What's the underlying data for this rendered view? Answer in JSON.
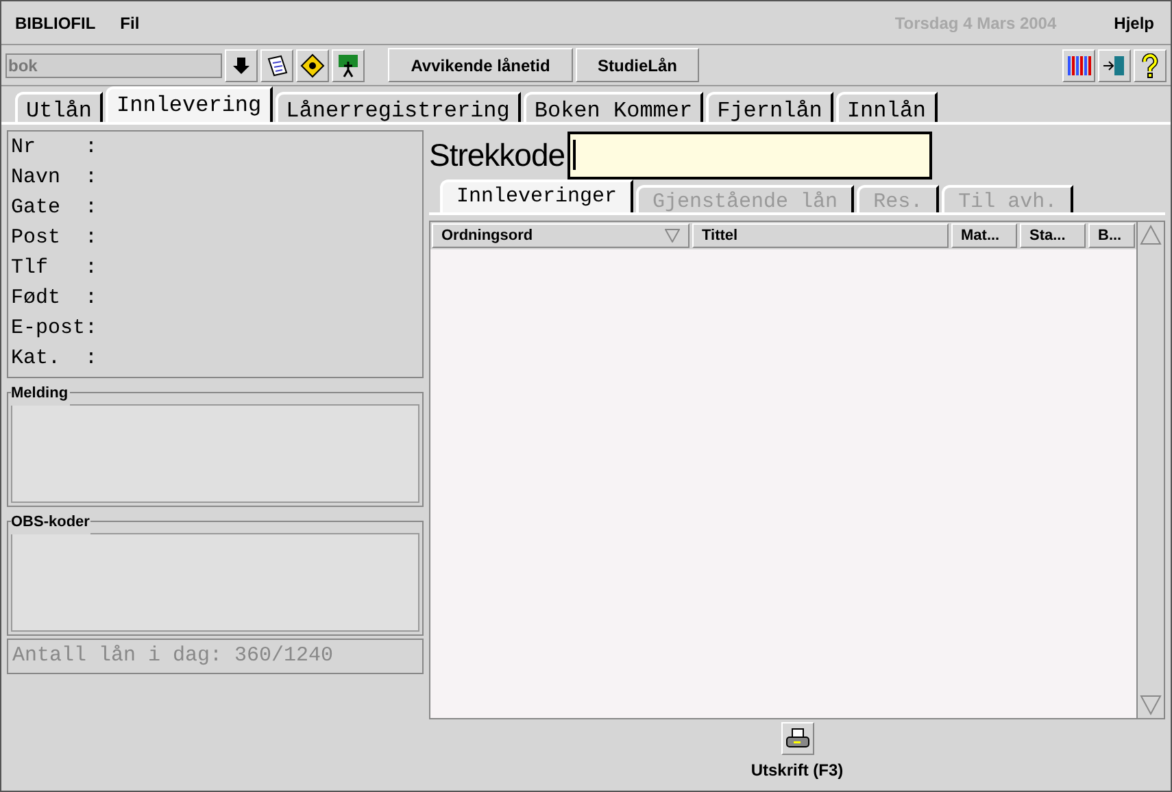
{
  "menu": {
    "app": "BIBLIOFIL",
    "items": [
      "Fil"
    ],
    "date": "Torsdag 4 Mars 2004",
    "help": "Hjelp"
  },
  "toolbar": {
    "search_value": "bok",
    "buttons": [
      "Avvikende lånetid",
      "StudieLån"
    ]
  },
  "tabs": [
    {
      "label": "Utlån",
      "selected": false
    },
    {
      "label": "Innlevering",
      "selected": true
    },
    {
      "label": "Lånerregistrering",
      "selected": false
    },
    {
      "label": "Boken Kommer",
      "selected": false
    },
    {
      "label": "Fjernlån",
      "selected": false
    },
    {
      "label": "Innlån",
      "selected": false
    }
  ],
  "borrower_fields": [
    "Nr    :",
    "Navn  :",
    "Gate  :",
    "Post  :",
    "Tlf   :",
    "Født  :",
    "E-post:",
    "Kat.  :"
  ],
  "message_box": {
    "title": "Melding"
  },
  "obs_box": {
    "title": "OBS-koder"
  },
  "loan_count": "Antall lån i dag: 360/1240",
  "barcode": {
    "label": "Strekkode"
  },
  "sub_tabs": [
    {
      "label": "Innleveringer",
      "selected": true,
      "disabled": false
    },
    {
      "label": "Gjenstående lån",
      "selected": false,
      "disabled": true
    },
    {
      "label": "Res.",
      "selected": false,
      "disabled": true
    },
    {
      "label": "Til avh.",
      "selected": false,
      "disabled": true
    }
  ],
  "table": {
    "columns": [
      {
        "label": "Ordningsord",
        "sorted": true
      },
      {
        "label": "Tittel",
        "sorted": false
      },
      {
        "label": "Mat...",
        "sorted": false
      },
      {
        "label": "Sta...",
        "sorted": false
      },
      {
        "label": "B...",
        "sorted": false
      }
    ]
  },
  "print_button": "Utskrift (F3)"
}
